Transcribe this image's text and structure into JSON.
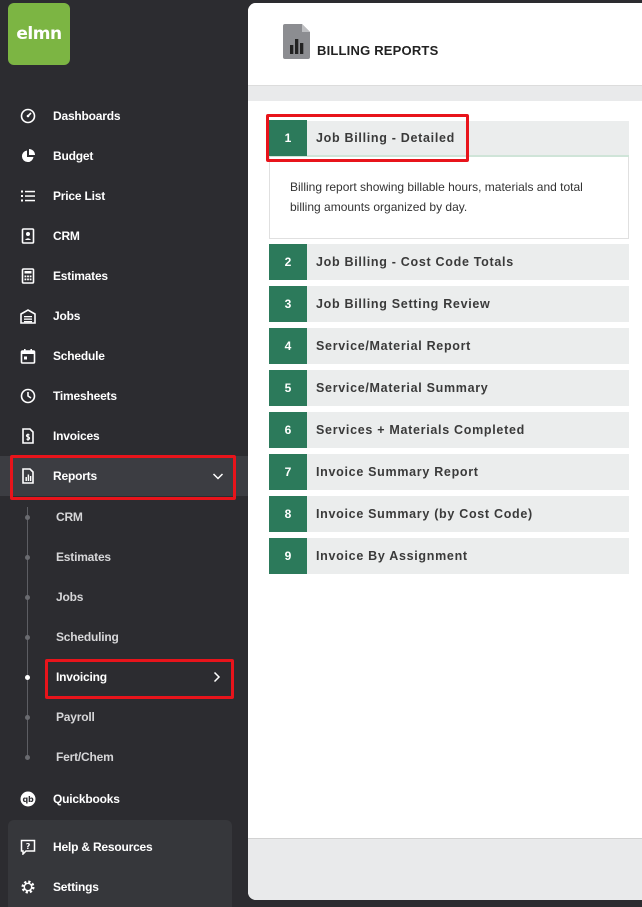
{
  "app": {
    "logo_text": "elmn"
  },
  "sidebar": {
    "items": [
      {
        "label": "Dashboards",
        "icon": "gauge-icon"
      },
      {
        "label": "Budget",
        "icon": "pie-chart-icon"
      },
      {
        "label": "Price List",
        "icon": "list-icon"
      },
      {
        "label": "CRM",
        "icon": "contact-card-icon"
      },
      {
        "label": "Estimates",
        "icon": "calculator-icon"
      },
      {
        "label": "Jobs",
        "icon": "garage-icon"
      },
      {
        "label": "Schedule",
        "icon": "calendar-icon"
      },
      {
        "label": "Timesheets",
        "icon": "clock-icon"
      },
      {
        "label": "Invoices",
        "icon": "invoice-icon"
      },
      {
        "label": "Reports",
        "icon": "report-icon"
      }
    ],
    "reports_submenu": [
      "CRM",
      "Estimates",
      "Jobs",
      "Scheduling",
      "Invoicing",
      "Payroll",
      "Fert/Chem"
    ],
    "quickbooks": "Quickbooks",
    "help": "Help & Resources",
    "settings": "Settings"
  },
  "main": {
    "title": "BILLING REPORTS",
    "reports": [
      {
        "num": "1",
        "label": "Job Billing - Detailed"
      },
      {
        "num": "2",
        "label": "Job Billing - Cost Code Totals"
      },
      {
        "num": "3",
        "label": "Job Billing Setting Review"
      },
      {
        "num": "4",
        "label": "Service/Material Report"
      },
      {
        "num": "5",
        "label": "Service/Material Summary"
      },
      {
        "num": "6",
        "label": "Services + Materials Completed"
      },
      {
        "num": "7",
        "label": "Invoice Summary Report"
      },
      {
        "num": "8",
        "label": "Invoice Summary (by Cost Code)"
      },
      {
        "num": "9",
        "label": "Invoice By Assignment"
      }
    ],
    "expanded_description": "Billing report showing billable hours, materials and total billing amounts organized by day."
  },
  "colors": {
    "accent_green": "#2c7a5b",
    "logo_green": "#7cb543",
    "highlight_red": "#e8141b",
    "sidebar_bg": "#2c2c30"
  }
}
